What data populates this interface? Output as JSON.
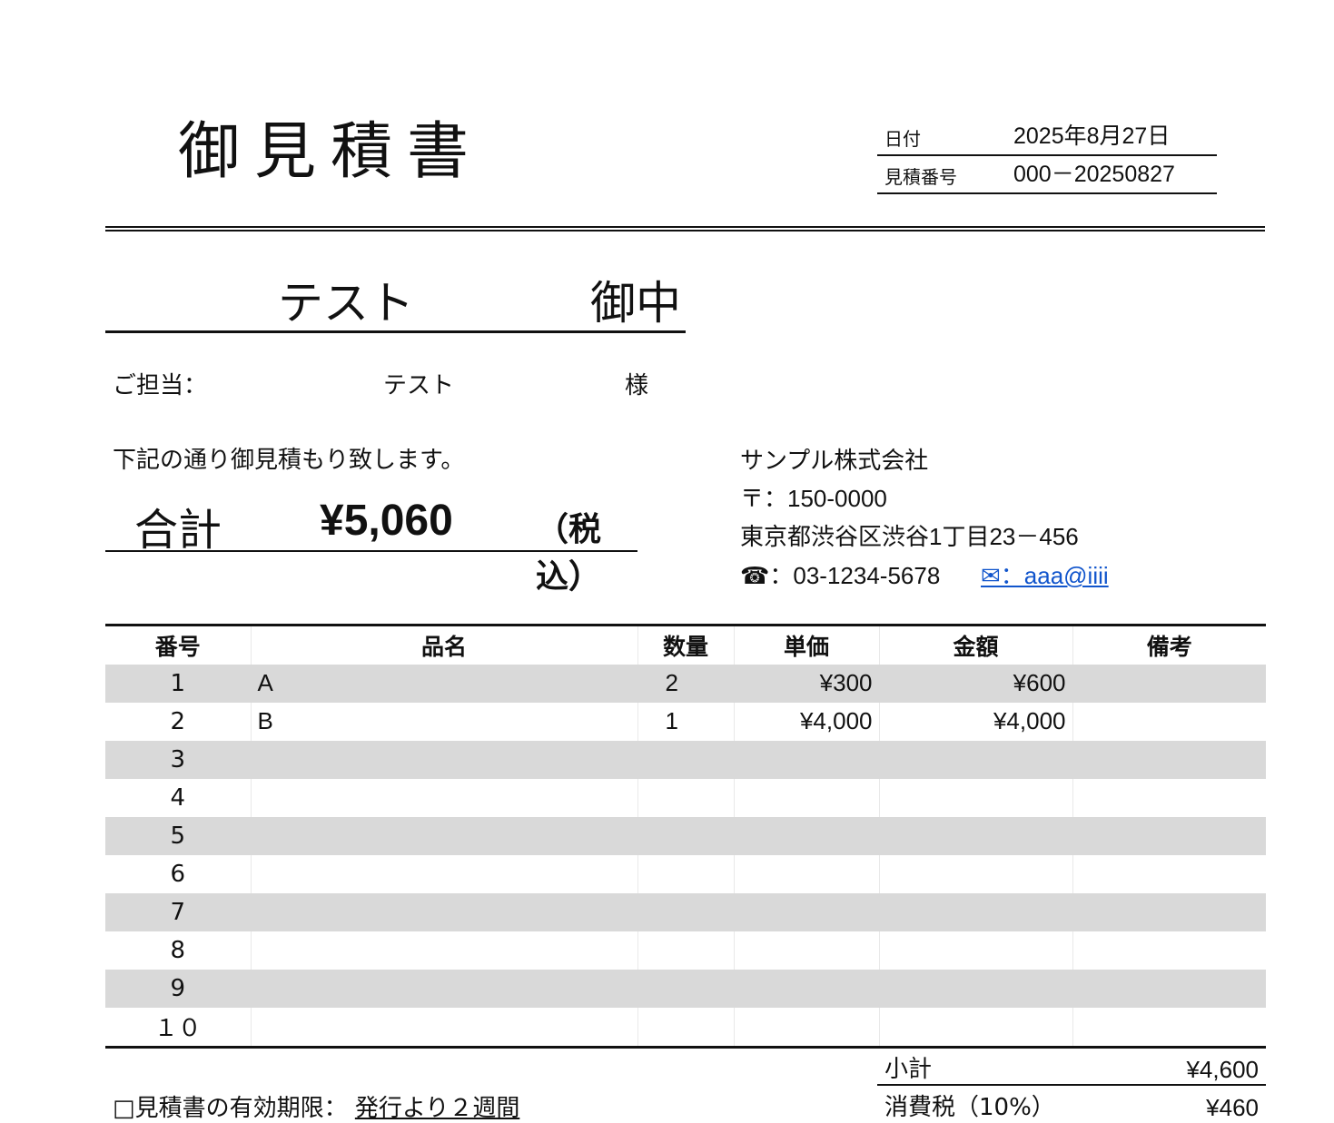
{
  "document": {
    "title": "御見積書",
    "meta": [
      {
        "label": "日付",
        "value": "2025年8月27日"
      },
      {
        "label": "見積番号",
        "value": "000－20250827"
      }
    ]
  },
  "client": {
    "name": "テスト",
    "honorific": "御中",
    "contact_label": "ご担当：",
    "contact_name": "テスト",
    "contact_honorific": "様"
  },
  "intro": "下記の通り御見積もり致します。",
  "total": {
    "label": "合計",
    "amount": "¥5,060",
    "tax_note": "（税込）"
  },
  "company": {
    "name": "サンプル株式会社",
    "postal": "〒：150-0000",
    "address": "東京都渋谷区渋谷1丁目23－456",
    "phone": "☎：03-1234-5678",
    "email": "✉：aaa@iiii"
  },
  "table": {
    "headers": [
      "番号",
      "品名",
      "数量",
      "単価",
      "金額",
      "備考"
    ],
    "rows": [
      {
        "no": "1",
        "item": "A",
        "qty": "2",
        "unit": "¥300",
        "amount": "¥600",
        "note": ""
      },
      {
        "no": "2",
        "item": "B",
        "qty": "1",
        "unit": "¥4,000",
        "amount": "¥4,000",
        "note": ""
      },
      {
        "no": "3",
        "item": "",
        "qty": "",
        "unit": "",
        "amount": "",
        "note": ""
      },
      {
        "no": "4",
        "item": "",
        "qty": "",
        "unit": "",
        "amount": "",
        "note": ""
      },
      {
        "no": "5",
        "item": "",
        "qty": "",
        "unit": "",
        "amount": "",
        "note": ""
      },
      {
        "no": "6",
        "item": "",
        "qty": "",
        "unit": "",
        "amount": "",
        "note": ""
      },
      {
        "no": "7",
        "item": "",
        "qty": "",
        "unit": "",
        "amount": "",
        "note": ""
      },
      {
        "no": "8",
        "item": "",
        "qty": "",
        "unit": "",
        "amount": "",
        "note": ""
      },
      {
        "no": "9",
        "item": "",
        "qty": "",
        "unit": "",
        "amount": "",
        "note": ""
      },
      {
        "no": "１０",
        "item": "",
        "qty": "",
        "unit": "",
        "amount": "",
        "note": ""
      }
    ]
  },
  "summary": {
    "subtotal_label": "小計",
    "subtotal_value": "¥4,600",
    "tax_label": "消費税（10%）",
    "tax_value": "¥460"
  },
  "validity": {
    "label": "□見積書の有効期限：",
    "value": "発行より２週間"
  }
}
